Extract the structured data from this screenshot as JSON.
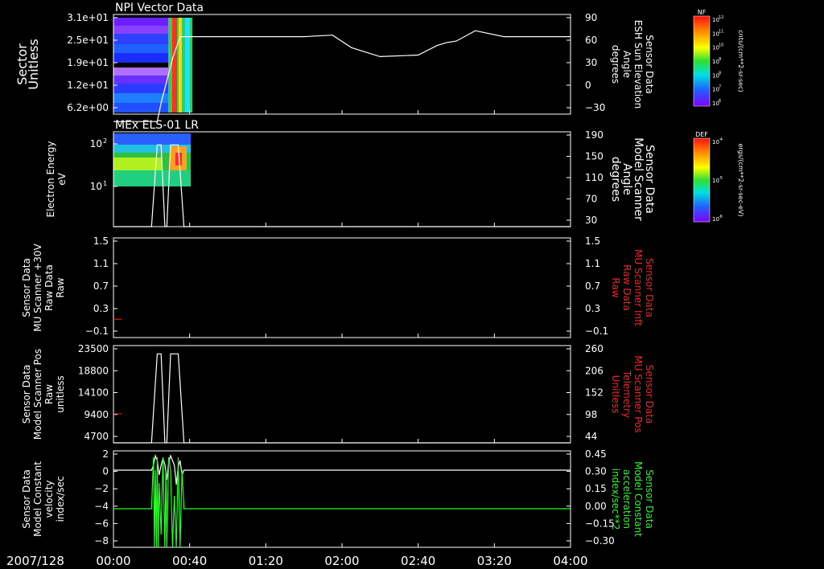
{
  "date_label": "2007/128",
  "x_ticks": [
    "00:00",
    "00:40",
    "01:20",
    "02:00",
    "02:40",
    "03:20",
    "04:00"
  ],
  "panels": [
    {
      "id": "npi",
      "title": "NPI Vector Data",
      "left_label": [
        "Sector",
        "Unitless"
      ],
      "right_label": [
        "Sensor Data",
        "ESH Sun Elevation",
        "Angle",
        "degrees"
      ],
      "right_label_color": "#ffffff",
      "left_ticks": [
        "3.1e+01",
        "2.5e+01",
        "1.9e+01",
        "1.2e+01",
        "6.2e+00"
      ],
      "right_ticks": [
        "90",
        "60",
        "30",
        "0",
        "−30"
      ]
    },
    {
      "id": "els",
      "title": "MEx ELS-01 LR",
      "left_label": [
        "Electron Energy",
        "eV"
      ],
      "right_label": [
        "Sensor Data",
        "Model Scanner",
        "Angle",
        "degrees"
      ],
      "right_label_color": "#ffffff",
      "left_ticks": [
        "10",
        "10"
      ],
      "left_tick_exponents": [
        "2",
        "1"
      ],
      "right_ticks": [
        "190",
        "150",
        "110",
        "70",
        "30"
      ]
    },
    {
      "id": "mu30",
      "title": "",
      "left_label": [
        "Sensor Data",
        "MU Scanner +30V",
        "Raw Data",
        "Raw"
      ],
      "right_label": [
        "Sensor Data",
        "MU Scanner Inft",
        "Raw Data",
        "Raw"
      ],
      "right_label_color": "#ff2020",
      "left_ticks": [
        "1.5",
        "1.1",
        "0.7",
        "0.3",
        "−0.1"
      ],
      "right_ticks": [
        "1.5",
        "1.1",
        "0.7",
        "0.3",
        "−0.1"
      ]
    },
    {
      "id": "pos",
      "title": "",
      "left_label": [
        "Sensor Data",
        "Model Scanner Pos",
        "Raw",
        "unitless"
      ],
      "right_label": [
        "Sensor Data",
        "MU Scanner Pos",
        "Telemetry",
        "Unitless"
      ],
      "right_label_color": "#ff2020",
      "left_ticks": [
        "23500",
        "18800",
        "14100",
        "9400",
        "4700"
      ],
      "right_ticks": [
        "260",
        "206",
        "152",
        "98",
        "44"
      ]
    },
    {
      "id": "vel",
      "title": "",
      "left_label": [
        "Sensor Data",
        "Model Constant",
        "velocity",
        "index/sec"
      ],
      "right_label": [
        "Sensor Data",
        "Model Constant",
        "acceleration",
        "index/sec**2"
      ],
      "right_label_color": "#20ff20",
      "left_ticks": [
        "2",
        "0",
        "−2",
        "−4",
        "−6",
        "−8"
      ],
      "right_ticks": [
        "0.45",
        "0.30",
        "0.15",
        "0.00",
        "−0.15",
        "−0.30"
      ]
    }
  ],
  "colorbars": [
    {
      "id": "nf",
      "title": "NF",
      "unit": "cnts/(cm**2-sr-sec)",
      "ticks": [
        "10",
        "10",
        "10",
        "10",
        "10",
        "10",
        "10"
      ],
      "tick_exponents": [
        "12",
        "11",
        "10",
        "9",
        "8",
        "7",
        "6"
      ]
    },
    {
      "id": "def",
      "title": "DEF",
      "unit": "ergs/(cm**2-sr-sec-eV)",
      "ticks": [
        "10",
        "10",
        "10"
      ],
      "tick_exponents": [
        "-4",
        "-5",
        "-6"
      ]
    }
  ],
  "chart_data": [
    {
      "type": "heatmap",
      "title": "NPI Vector Data",
      "ylabel": "Sector Unitless",
      "y2label": "Sensor Data ESH Sun Elevation Angle degrees",
      "x_range": [
        "00:00",
        "04:00"
      ],
      "ylim": [
        0,
        31
      ],
      "y2lim": [
        -45,
        90
      ],
      "note": "spectrogram present 00:00-00:37; elevation line overlay",
      "line_series": {
        "name": "ESH Sun Elevation Angle",
        "x_min": [
          0,
          23,
          25,
          28,
          31,
          35,
          40,
          60,
          80,
          100,
          115,
          125,
          140,
          160,
          170,
          175,
          180,
          190,
          205,
          220,
          240
        ],
        "y": [
          -55,
          -55,
          -30,
          0,
          30,
          60,
          60,
          60,
          60,
          60,
          62,
          45,
          33,
          35,
          48,
          52,
          54,
          68,
          60,
          60,
          60
        ]
      }
    },
    {
      "type": "heatmap",
      "title": "MEx ELS-01 LR",
      "ylabel": "Electron Energy eV",
      "y2label": "Sensor Data Model Scanner Angle degrees",
      "x_range": [
        "00:00",
        "04:00"
      ],
      "y_scale": "log",
      "ylim": [
        2,
        180
      ],
      "y2lim": [
        10,
        190
      ],
      "line_series": {
        "name": "Model Scanner Angle",
        "x_min": [
          0,
          20,
          23,
          25,
          27,
          28,
          30,
          32,
          34,
          37,
          240
        ],
        "y": [
          10,
          10,
          165,
          165,
          10,
          10,
          165,
          165,
          165,
          10,
          10
        ]
      }
    },
    {
      "type": "line",
      "ylabel": "Sensor Data MU Scanner +30V Raw Data Raw",
      "y2label": "Sensor Data MU Scanner Inft Raw Data Raw",
      "x_range": [
        "00:00",
        "04:00"
      ],
      "ylim": [
        -0.4,
        1.5
      ],
      "series": [
        {
          "name": "MU Scanner +30V",
          "color": "#ff2020",
          "x_min": [
            0,
            1
          ],
          "y": [
            -0.05,
            -0.05
          ]
        }
      ]
    },
    {
      "type": "line",
      "ylabel": "Sensor Data Model Scanner Pos Raw unitless",
      "y2label": "Sensor Data MU Scanner Pos Telemetry Unitless",
      "x_range": [
        "00:00",
        "04:00"
      ],
      "ylim": [
        0,
        23500
      ],
      "y2lim": [
        0,
        260
      ],
      "series": [
        {
          "name": "Model Scanner Pos",
          "color": "#ffffff",
          "x_min": [
            0,
            20,
            23,
            25,
            27,
            28,
            30,
            32,
            34,
            37,
            240
          ],
          "y": [
            0,
            0,
            21500,
            21500,
            0,
            0,
            21500,
            21500,
            21500,
            0,
            0
          ]
        },
        {
          "name": "MU Scanner Pos",
          "color": "#ff2020",
          "x_min": [
            0,
            1
          ],
          "y": [
            7000,
            7000
          ]
        }
      ]
    },
    {
      "type": "line",
      "ylabel": "Sensor Data Model Constant velocity index/sec",
      "y2label": "Sensor Data Model Constant acceleration index/sec**2",
      "x_range": [
        "00:00",
        "04:00"
      ],
      "ylim": [
        -8,
        2
      ],
      "y2lim": [
        -0.3,
        0.45
      ],
      "series": [
        {
          "name": "velocity",
          "color": "#ffffff",
          "x_min": [
            0,
            20,
            21,
            22,
            23,
            24,
            25,
            26,
            27,
            28,
            29,
            30,
            31,
            32,
            33,
            34,
            35,
            36,
            37,
            240
          ],
          "y": [
            0,
            0,
            0.5,
            1.5,
            1.0,
            -0.5,
            0.5,
            1.2,
            0.6,
            -1.0,
            0.8,
            1.5,
            1.0,
            0.5,
            -1.5,
            0.3,
            1.0,
            -0.5,
            0,
            0
          ]
        },
        {
          "name": "acceleration",
          "color": "#20ff20",
          "x_min": [
            0,
            20,
            21,
            21.5,
            22,
            22.5,
            23,
            23.5,
            24,
            25,
            26,
            27,
            27.5,
            28,
            29,
            30,
            31,
            32,
            33,
            34,
            35,
            36,
            37,
            240
          ],
          "y": [
            0,
            0,
            0.4,
            -0.3,
            0.3,
            -0.3,
            0.4,
            -0.3,
            0.2,
            -0.2,
            0.4,
            -0.3,
            0.3,
            -0.3,
            0.4,
            0.3,
            -0.3,
            0.1,
            -0.3,
            0.4,
            -0.3,
            0.3,
            0,
            0
          ]
        }
      ]
    }
  ]
}
